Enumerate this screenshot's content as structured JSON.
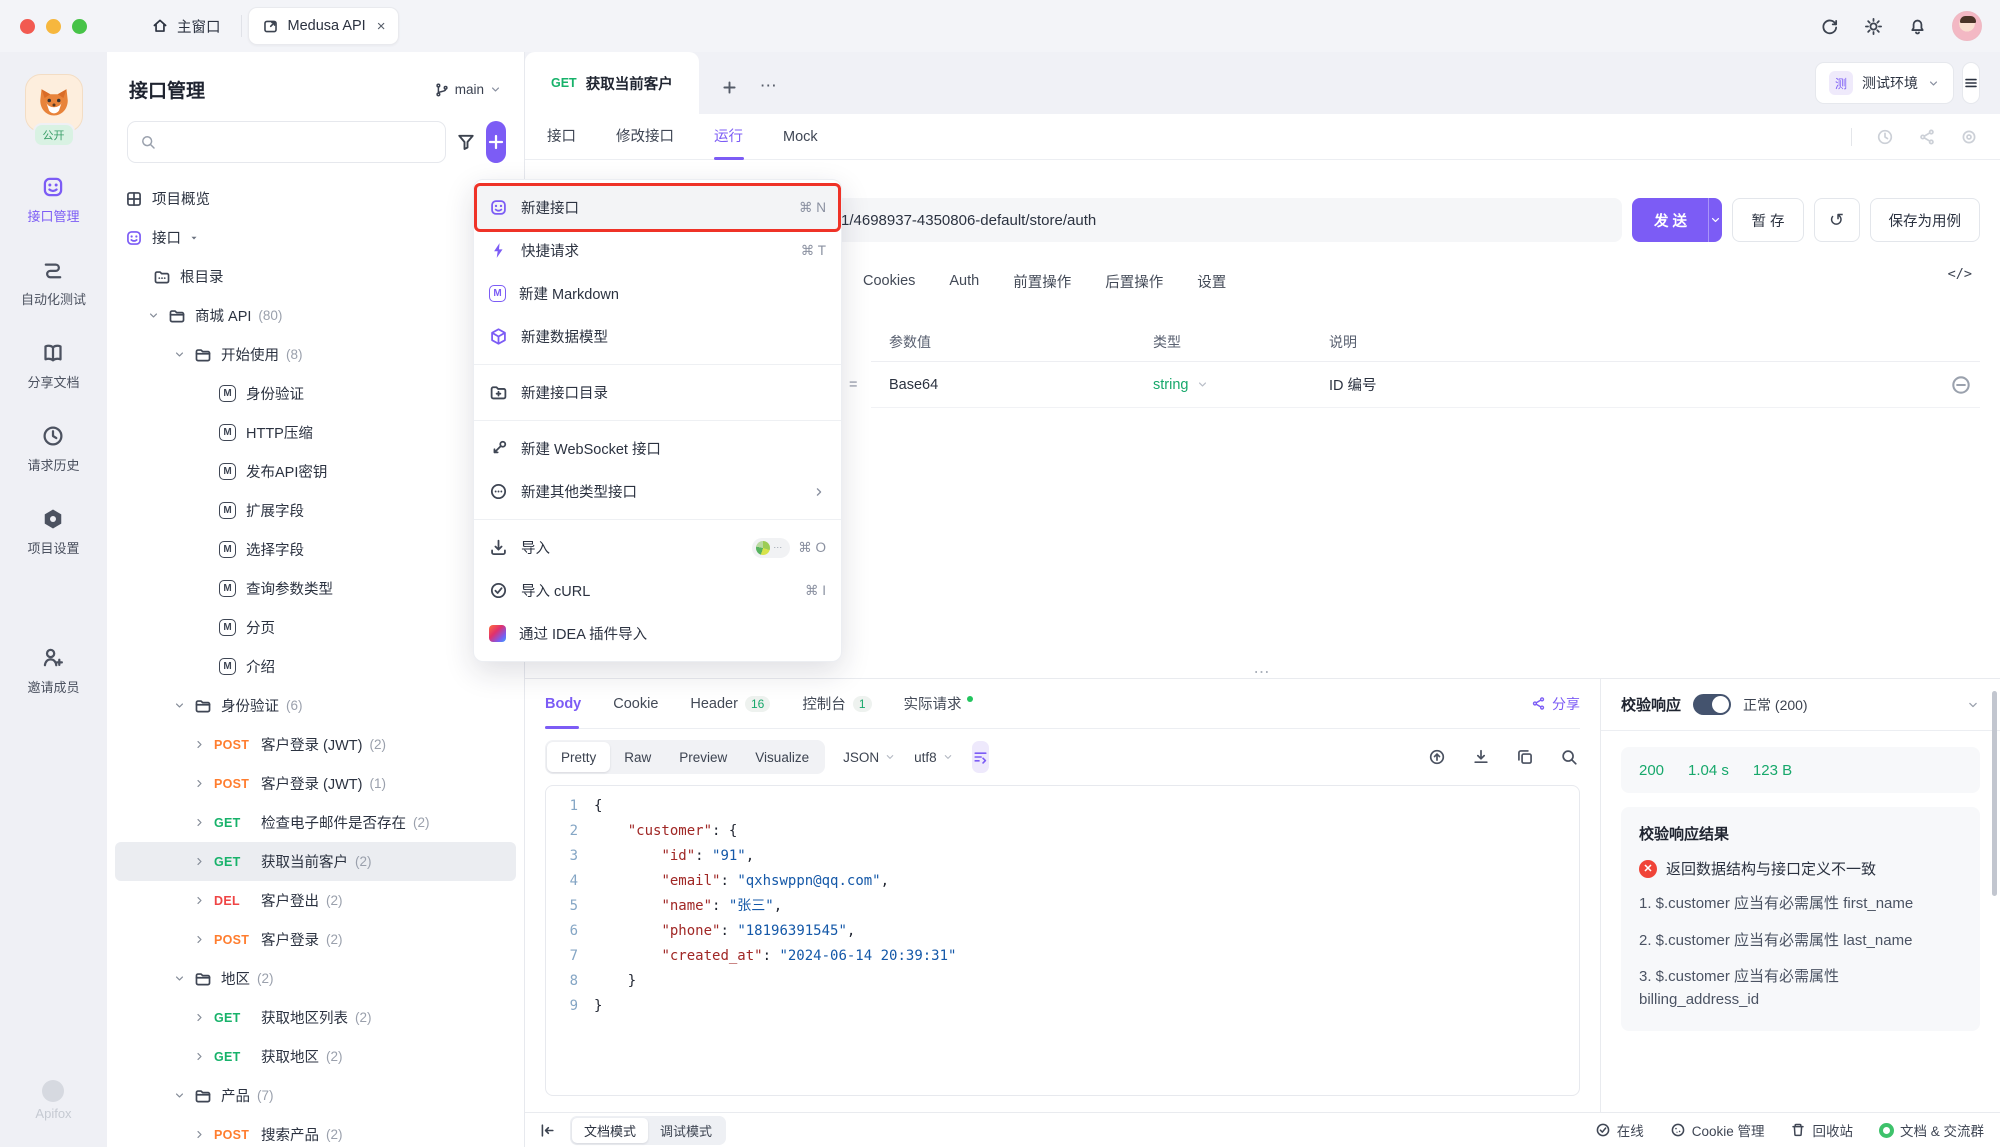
{
  "window": {
    "home_tab": "主窗口",
    "project_tab": "Medusa API",
    "close": "×"
  },
  "sidebar": {
    "public_badge": "公开",
    "items": [
      {
        "label": "接口管理",
        "icon": "api",
        "active": true
      },
      {
        "label": "自动化测试",
        "icon": "auto",
        "active": false
      },
      {
        "label": "分享文档",
        "icon": "book",
        "active": false
      },
      {
        "label": "请求历史",
        "icon": "clock",
        "active": false
      },
      {
        "label": "项目设置",
        "icon": "hexgear",
        "active": false
      },
      {
        "label": "邀请成员",
        "icon": "invite",
        "active": false
      }
    ],
    "watermark": "Apifox"
  },
  "explorer": {
    "title": "接口管理",
    "branch": "main",
    "tree": [
      {
        "kind": "section",
        "icon": "grid",
        "label": "项目概览"
      },
      {
        "kind": "section",
        "icon": "api",
        "label": "接口",
        "caret": true
      },
      {
        "kind": "root",
        "icon": "folder-root",
        "label": "根目录"
      },
      {
        "kind": "folder",
        "level": 1,
        "label": "商城 API",
        "count": "(80)"
      },
      {
        "kind": "folder",
        "level": 2,
        "label": "开始使用",
        "count": "(8)"
      },
      {
        "kind": "doc",
        "label": "身份验证"
      },
      {
        "kind": "doc",
        "label": "HTTP压缩"
      },
      {
        "kind": "doc",
        "label": "发布API密钥"
      },
      {
        "kind": "doc",
        "label": "扩展字段"
      },
      {
        "kind": "doc",
        "label": "选择字段"
      },
      {
        "kind": "doc",
        "label": "查询参数类型"
      },
      {
        "kind": "doc",
        "label": "分页"
      },
      {
        "kind": "doc",
        "label": "介绍"
      },
      {
        "kind": "folder",
        "level": 2,
        "label": "身份验证",
        "count": "(6)"
      },
      {
        "kind": "req",
        "method": "POST",
        "label": "客户登录 (JWT)",
        "count": "(2)"
      },
      {
        "kind": "req",
        "method": "POST",
        "label": "客户登录 (JWT)",
        "count": "(1)"
      },
      {
        "kind": "req",
        "method": "GET",
        "label": "检查电子邮件是否存在",
        "count": "(2)"
      },
      {
        "kind": "req",
        "method": "GET",
        "label": "获取当前客户",
        "count": "(2)",
        "selected": true
      },
      {
        "kind": "req",
        "method": "DEL",
        "label": "客户登出",
        "count": "(2)"
      },
      {
        "kind": "req",
        "method": "POST",
        "label": "客户登录",
        "count": "(2)"
      },
      {
        "kind": "folder",
        "level": 2,
        "label": "地区",
        "count": "(2)"
      },
      {
        "kind": "req",
        "method": "GET",
        "label": "获取地区列表",
        "count": "(2)"
      },
      {
        "kind": "req",
        "method": "GET",
        "label": "获取地区",
        "count": "(2)"
      },
      {
        "kind": "folder",
        "level": 2,
        "label": "产品",
        "count": "(7)"
      },
      {
        "kind": "req",
        "method": "POST",
        "label": "搜索产品",
        "count": "(2)"
      }
    ]
  },
  "menu": {
    "items": [
      {
        "icon": "api",
        "label": "新建接口",
        "shortcut": "⌘ N",
        "highlight": true,
        "purple": true
      },
      {
        "icon": "bolt",
        "label": "快捷请求",
        "shortcut": "⌘ T",
        "purple": true
      },
      {
        "icon": "md",
        "label": "新建 Markdown",
        "purple": true
      },
      {
        "icon": "cube",
        "label": "新建数据模型",
        "purple": true,
        "divider_after": true
      },
      {
        "icon": "folder-plus",
        "label": "新建接口目录",
        "divider_after": true
      },
      {
        "icon": "ws",
        "label": "新建 WebSocket 接口"
      },
      {
        "icon": "dots-circle",
        "label": "新建其他类型接口",
        "submenu": true,
        "divider_after": true
      },
      {
        "icon": "import",
        "label": "导入",
        "shortcut": "⌘ O",
        "badge": true
      },
      {
        "icon": "check-circle",
        "label": "导入 cURL",
        "shortcut": "⌘ I"
      },
      {
        "icon": "idea",
        "label": "通过 IDEA 插件导入"
      }
    ]
  },
  "main": {
    "tab_method": "GET",
    "tab_title": "获取当前客户",
    "env_badge": "测",
    "env_label": "测试环境",
    "subnav": [
      {
        "label": "接口",
        "active": false
      },
      {
        "label": "修改接口",
        "active": false
      },
      {
        "label": "运行",
        "active": true
      },
      {
        "label": "Mock",
        "active": false
      }
    ],
    "url": "1/4698937-4350806-default/store/auth",
    "send": "发 送",
    "stash": "暂 存",
    "save_case": "保存为用例",
    "config_tabs": [
      "Cookies",
      "Auth",
      "前置操作",
      "后置操作",
      "设置"
    ],
    "code_tag": "</>",
    "params": {
      "col_value": "参数值",
      "col_type": "类型",
      "col_desc": "说明",
      "row_value": "Base64",
      "row_type": "string",
      "row_desc": "ID 编号"
    },
    "splitter": "⋯"
  },
  "response": {
    "tabs": [
      {
        "label": "Body",
        "active": true
      },
      {
        "label": "Cookie"
      },
      {
        "label": "Header",
        "badge": "16"
      },
      {
        "label": "控制台",
        "badge": "1"
      },
      {
        "label": "实际请求",
        "dot": true
      }
    ],
    "share": "分享",
    "views": [
      {
        "label": "Pretty",
        "active": true
      },
      {
        "label": "Raw"
      },
      {
        "label": "Preview"
      },
      {
        "label": "Visualize"
      }
    ],
    "lang": "JSON",
    "encoding": "utf8",
    "code": {
      "lines": [
        [
          [
            "{",
            "p"
          ]
        ],
        [
          [
            "    ",
            "w"
          ],
          [
            "\"customer\"",
            "k"
          ],
          [
            ": ",
            "p"
          ],
          [
            "{",
            "p"
          ]
        ],
        [
          [
            "        ",
            "w"
          ],
          [
            "\"id\"",
            "k"
          ],
          [
            ": ",
            "p"
          ],
          [
            "\"91\"",
            "s"
          ],
          [
            ",",
            "p"
          ]
        ],
        [
          [
            "        ",
            "w"
          ],
          [
            "\"email\"",
            "k"
          ],
          [
            ": ",
            "p"
          ],
          [
            "\"qxhswppn@qq.com\"",
            "s"
          ],
          [
            ",",
            "p"
          ]
        ],
        [
          [
            "        ",
            "w"
          ],
          [
            "\"name\"",
            "k"
          ],
          [
            ": ",
            "p"
          ],
          [
            "\"张三\"",
            "s"
          ],
          [
            ",",
            "p"
          ]
        ],
        [
          [
            "        ",
            "w"
          ],
          [
            "\"phone\"",
            "k"
          ],
          [
            ": ",
            "p"
          ],
          [
            "\"18196391545\"",
            "s"
          ],
          [
            ",",
            "p"
          ]
        ],
        [
          [
            "        ",
            "w"
          ],
          [
            "\"created_at\"",
            "k"
          ],
          [
            ": ",
            "p"
          ],
          [
            "\"2024-06-14 20:39:31\"",
            "s"
          ]
        ],
        [
          [
            "    ",
            "w"
          ],
          [
            "}",
            "p"
          ]
        ],
        [
          [
            "}",
            "p"
          ]
        ]
      ]
    }
  },
  "validation": {
    "title": "校验响应",
    "status": "正常 (200)",
    "stats": [
      "200",
      "1.04 s",
      "123 B"
    ],
    "result_title": "校验响应结果",
    "error": "返回数据结构与接口定义不一致",
    "issues": [
      "1. $.customer 应当有必需属性 first_name",
      "2. $.customer 应当有必需属性 last_name",
      "3. $.customer 应当有必需属性 billing_address_id"
    ]
  },
  "statusbar": {
    "modes": [
      {
        "label": "文档模式",
        "active": true
      },
      {
        "label": "调试模式",
        "active": false
      }
    ],
    "right": [
      {
        "icon": "check-circle",
        "label": "在线"
      },
      {
        "icon": "cookie",
        "label": "Cookie 管理"
      },
      {
        "icon": "trash",
        "label": "回收站"
      },
      {
        "icon": "chat",
        "label": "文档 & 交流群"
      }
    ]
  }
}
